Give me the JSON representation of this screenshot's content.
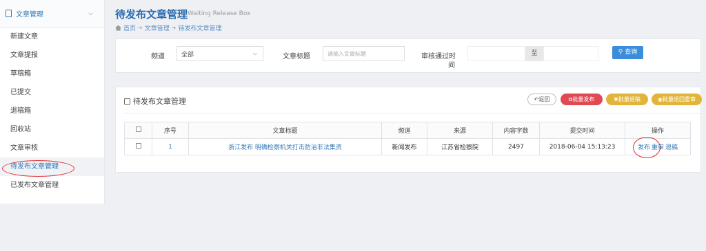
{
  "sidebar": {
    "header": "文章管理",
    "items": [
      {
        "label": "新建文章"
      },
      {
        "label": "文章提报"
      },
      {
        "label": "草稿箱"
      },
      {
        "label": "已提交"
      },
      {
        "label": "退稿箱"
      },
      {
        "label": "回收站"
      },
      {
        "label": "文章审核"
      },
      {
        "label": "待发布文章管理"
      },
      {
        "label": "已发布文章管理"
      }
    ]
  },
  "header": {
    "title": "待发布文章管理",
    "subtitle": "Waiting Release Box",
    "breadcrumb": [
      "首页",
      "文章管理",
      "待发布文章管理"
    ]
  },
  "filter": {
    "channel_label": "频道",
    "channel_value": "全部",
    "title_label": "文章标题",
    "title_placeholder": "请输入文章标题",
    "time_label_1": "审核通过时",
    "time_label_2": "间",
    "to_label": "至",
    "search_label": "查询"
  },
  "panel": {
    "title": "待发布文章管理",
    "back_label": "返回",
    "publish_label": "批量发布",
    "return_label": "批量退稿",
    "release_label": "批量退回重审"
  },
  "table": {
    "headers": [
      "",
      "序号",
      "文章标题",
      "频道",
      "来源",
      "内容字数",
      "提交时间",
      "操作"
    ],
    "rows": [
      {
        "index": "1",
        "title": "浙江发布 明确检察机关打击防治非法集资",
        "channel": "新闻发布",
        "source": "江苏省检察院",
        "words": "2497",
        "time": "2018-06-04 15:13:23",
        "op1": "发布",
        "op2": "重审",
        "op3": "退稿"
      }
    ]
  },
  "colors": {
    "accent": "#337ab7",
    "danger": "#e04a55",
    "warning": "#e2b53a",
    "annotation": "#e12d2d"
  }
}
